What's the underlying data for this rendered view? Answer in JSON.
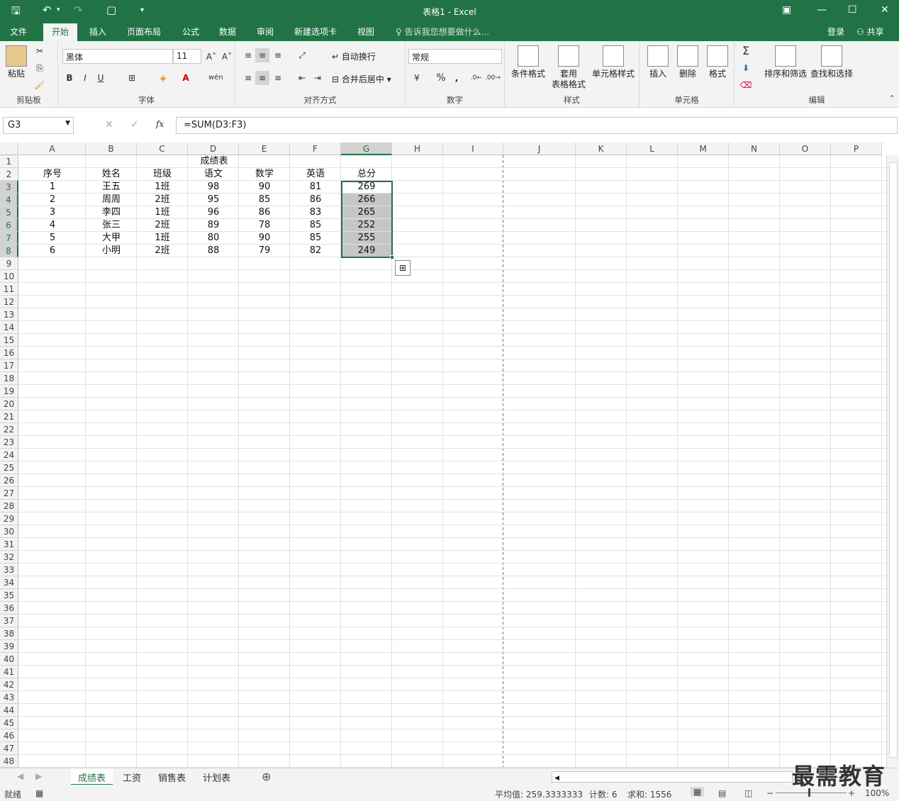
{
  "titlebar": {
    "title": "表格1 - Excel"
  },
  "tabs": {
    "file": "文件",
    "home": "开始",
    "insert": "插入",
    "layout": "页面布局",
    "formulas": "公式",
    "data": "数据",
    "review": "审阅",
    "newtab": "新建选项卡",
    "view": "视图",
    "tellme": "告诉我您想要做什么...",
    "login": "登录",
    "share": "共享"
  },
  "ribbon": {
    "clipboard": {
      "paste": "粘贴",
      "label": "剪贴板"
    },
    "font": {
      "name": "黑体",
      "size": "11",
      "bold": "B",
      "italic": "I",
      "underline": "U",
      "label": "字体"
    },
    "align": {
      "wrap": "自动换行",
      "merge": "合并后居中",
      "label": "对齐方式"
    },
    "number": {
      "format": "常规",
      "percent": "%",
      "comma": ",",
      "label": "数字"
    },
    "styles": {
      "cond": "条件格式",
      "table1": "套用",
      "table2": "表格格式",
      "cell": "单元格样式",
      "label": "样式"
    },
    "cells": {
      "insert": "插入",
      "delete": "删除",
      "format": "格式",
      "label": "单元格"
    },
    "edit": {
      "sort": "排序和筛选",
      "find": "查找和选择",
      "label": "编辑"
    }
  },
  "formula_bar": {
    "namebox": "G3",
    "formula": "=SUM(D3:F3)",
    "fx": "fx"
  },
  "columns": [
    "A",
    "B",
    "C",
    "D",
    "E",
    "F",
    "G",
    "H",
    "I",
    "J",
    "K",
    "L",
    "M",
    "N",
    "O",
    "P"
  ],
  "sheet": {
    "title": "成绩表",
    "headers": [
      "序号",
      "姓名",
      "班级",
      "语文",
      "数学",
      "英语",
      "总分"
    ],
    "rows": [
      [
        "1",
        "王五",
        "1班",
        "98",
        "90",
        "81",
        "269"
      ],
      [
        "2",
        "周周",
        "2班",
        "95",
        "85",
        "86",
        "266"
      ],
      [
        "3",
        "李四",
        "1班",
        "96",
        "86",
        "83",
        "265"
      ],
      [
        "4",
        "张三",
        "2班",
        "89",
        "78",
        "85",
        "252"
      ],
      [
        "5",
        "大甲",
        "1班",
        "80",
        "90",
        "85",
        "255"
      ],
      [
        "6",
        "小明",
        "2班",
        "88",
        "79",
        "82",
        "249"
      ]
    ]
  },
  "sheet_tabs": [
    "成绩表",
    "工资",
    "销售表",
    "计划表"
  ],
  "status": {
    "ready": "就绪",
    "avg": "平均值: 259.3333333",
    "count": "计数: 6",
    "sum": "求和: 1556",
    "zoom": "100%"
  },
  "watermark": "最需教育"
}
